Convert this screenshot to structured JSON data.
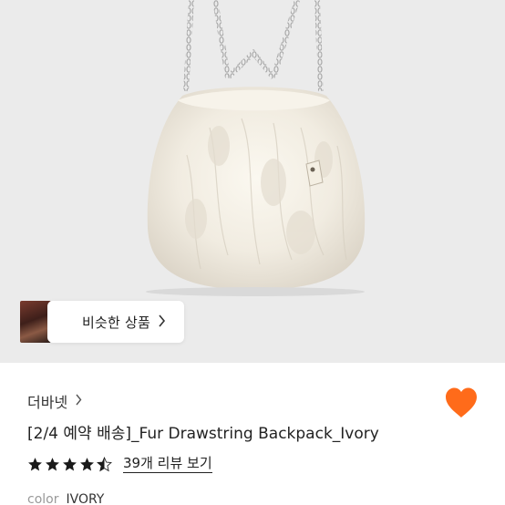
{
  "similar_products": {
    "label": "비슷한 상품"
  },
  "product": {
    "brand": "더바넷",
    "title": "[2/4 예약 배송]_Fur Drawstring Backpack_Ivory",
    "rating": 4.5,
    "rating_max": 5,
    "review_link": "39개 리뷰 보기",
    "option_key": "color",
    "option_value": "IVORY",
    "liked": true
  },
  "colors": {
    "heart": "#ff6b1a",
    "star": "#1a1a1a",
    "hero_bg": "#ebebeb"
  },
  "icons": {
    "brand_chevron": "chevron-right-icon",
    "similar_chevron": "chevron-right-icon",
    "like": "heart-icon"
  }
}
